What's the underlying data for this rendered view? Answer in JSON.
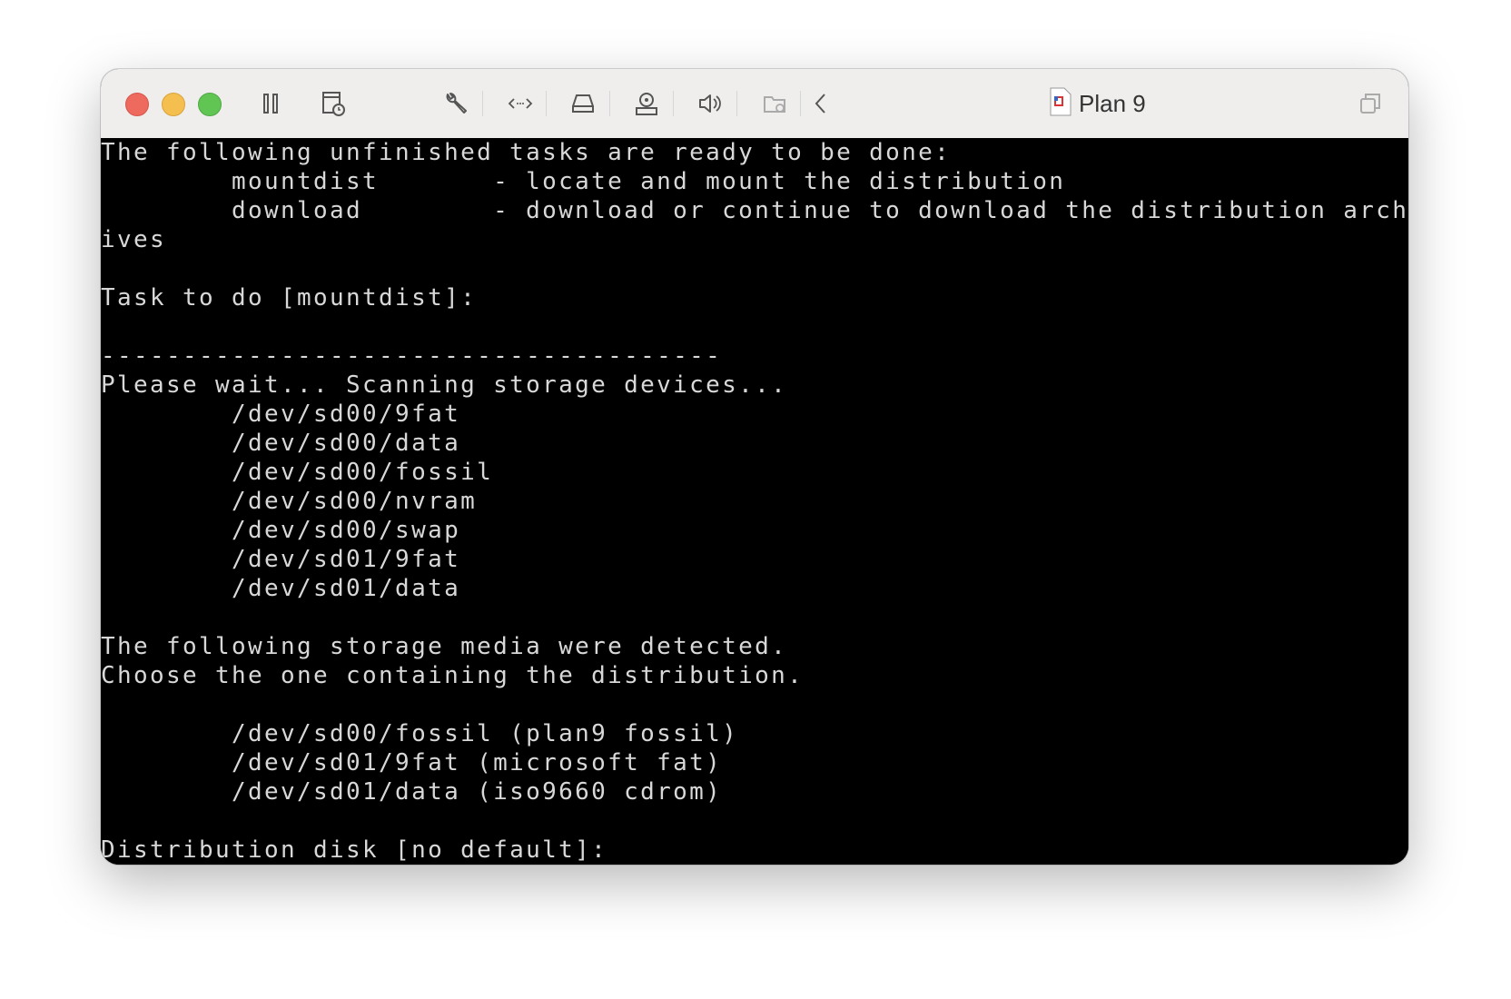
{
  "window": {
    "title": "Plan 9",
    "traffic_lights": {
      "close": "#ee6a5f",
      "minimize": "#f5bf4f",
      "zoom": "#61c554"
    },
    "toolbar_icons": [
      "pause-icon",
      "snapshot-icon",
      "wrench-icon",
      "code-icon",
      "disk-icon",
      "usb-icon",
      "speaker-icon",
      "shared-folder-icon",
      "chevron-left-icon"
    ],
    "right_icon": "copy-window-icon"
  },
  "console": {
    "foreground": "#d8d8d8",
    "background": "#000000",
    "lines": [
      "The following unfinished tasks are ready to be done:",
      "        mountdist       - locate and mount the distribution",
      "        download        - download or continue to download the distribution arch",
      "ives",
      "",
      "Task to do [mountdist]:",
      "",
      "--------------------------------------",
      "Please wait... Scanning storage devices...",
      "        /dev/sd00/9fat",
      "        /dev/sd00/data",
      "        /dev/sd00/fossil",
      "        /dev/sd00/nvram",
      "        /dev/sd00/swap",
      "        /dev/sd01/9fat",
      "        /dev/sd01/data",
      "",
      "The following storage media were detected.",
      "Choose the one containing the distribution.",
      "",
      "        /dev/sd00/fossil (plan9 fossil)",
      "        /dev/sd01/9fat (microsoft fat)",
      "        /dev/sd01/data (iso9660 cdrom)",
      "",
      "Distribution disk [no default]:"
    ]
  }
}
